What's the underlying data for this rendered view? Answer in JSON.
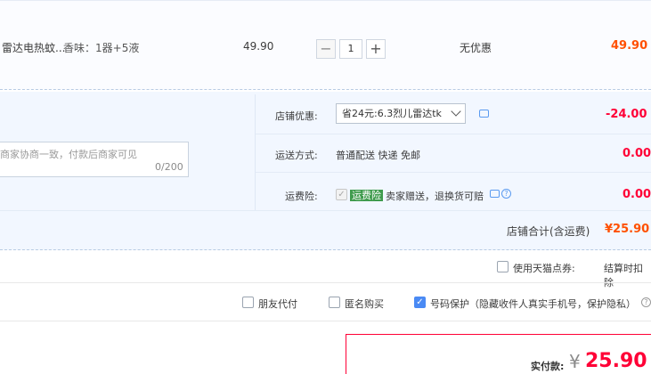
{
  "item": {
    "title": "雷达电热蚊...",
    "sku": "香味：1器+5液",
    "unit_price": "49.90",
    "quantity": "1",
    "qty_minus": "−",
    "qty_plus": "+",
    "discount": "无优惠",
    "subtotal": "49.90"
  },
  "memo": {
    "placeholder": "商家协商一致，付款后商家可见",
    "counter": "0/200"
  },
  "shop": {
    "coupon_label": "店铺优惠:",
    "coupon_selected": "省24元:6.3烈儿雷达tk",
    "coupon_amount": "-24.00",
    "shipping_label": "运送方式:",
    "shipping_value": "普通配送 快递 免邮",
    "shipping_amount": "0.00",
    "insurance_label": "运费险:",
    "insurance_tag": "运费险",
    "insurance_text": "卖家赠送，退换货可赔",
    "insurance_amount": "0.00",
    "total_label": "店铺合计(含运费)",
    "total_amount": "¥25.90"
  },
  "tmall_points": {
    "label": "使用天猫点券:",
    "note": "结算时扣除"
  },
  "options": {
    "friend_pay": "朋友代付",
    "anonymous": "匿名购买",
    "number_protect": "号码保护（隐藏收件人真实手机号，保护隐私）"
  },
  "pay": {
    "label": "实付款:",
    "currency": "¥",
    "amount": "25.90"
  },
  "colors": {
    "accent_red": "#ff0036",
    "price_orange": "#ff5000",
    "checkbox_blue": "#4a8af4",
    "tag_green": "#3f9b4d"
  }
}
